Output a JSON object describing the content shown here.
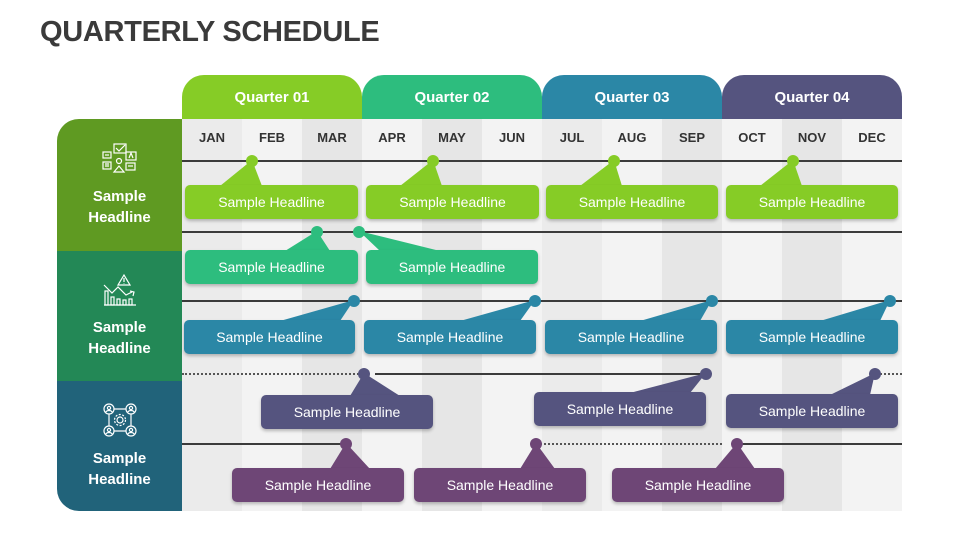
{
  "title": "QUARTERLY SCHEDULE",
  "colors": {
    "q1": "#86cc26",
    "q2": "#2dbd7e",
    "q3": "#2b87a6",
    "q4": "#55547f",
    "purple": "#6e4676",
    "side1": "#5f9a22",
    "side2": "#238856",
    "side3": "#21637a"
  },
  "quarters": [
    {
      "label": "Quarter 01"
    },
    {
      "label": "Quarter 02"
    },
    {
      "label": "Quarter 03"
    },
    {
      "label": "Quarter 04"
    }
  ],
  "months": [
    "JAN",
    "FEB",
    "MAR",
    "APR",
    "MAY",
    "JUN",
    "JUL",
    "AUG",
    "SEP",
    "OCT",
    "NOV",
    "DEC"
  ],
  "sidebar": [
    {
      "label": "Sample Headline",
      "icon": "feedback-chat-icon"
    },
    {
      "label": "Sample Headline",
      "icon": "risk-decline-chart-icon"
    },
    {
      "label": "Sample Headline",
      "icon": "team-network-gear-icon"
    }
  ],
  "callouts": [
    {
      "label": "Sample Headline"
    },
    {
      "label": "Sample Headline"
    },
    {
      "label": "Sample Headline"
    },
    {
      "label": "Sample Headline"
    },
    {
      "label": "Sample Headline"
    },
    {
      "label": "Sample Headline"
    },
    {
      "label": "Sample Headline"
    },
    {
      "label": "Sample Headline"
    },
    {
      "label": "Sample Headline"
    },
    {
      "label": "Sample Headline"
    },
    {
      "label": "Sample Headline"
    },
    {
      "label": "Sample Headline"
    },
    {
      "label": "Sample Headline"
    },
    {
      "label": "Sample Headline"
    },
    {
      "label": "Sample Headline"
    },
    {
      "label": "Sample Headline"
    }
  ]
}
